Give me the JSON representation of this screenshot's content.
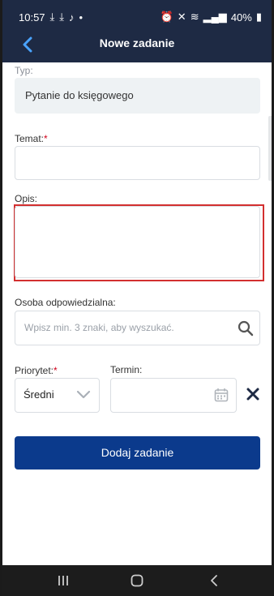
{
  "status_bar": {
    "time": "10:57",
    "battery": "40%"
  },
  "header": {
    "title": "Nowe zadanie"
  },
  "form": {
    "type_label": "Typ:",
    "type_value": "Pytanie do księgowego",
    "subject_label": "Temat:",
    "required_mark": "*",
    "description_label": "Opis:",
    "assignee_label": "Osoba odpowiedzialna:",
    "assignee_placeholder": "Wpisz min. 3 znaki, aby wyszukać.",
    "priority_label": "Priorytet:",
    "priority_value": "Średni",
    "deadline_label": "Termin:",
    "submit_label": "Dodaj zadanie"
  },
  "colors": {
    "header_bg": "#1e2a44",
    "button_bg": "#0b3a8c",
    "highlight": "#d32f2f"
  }
}
